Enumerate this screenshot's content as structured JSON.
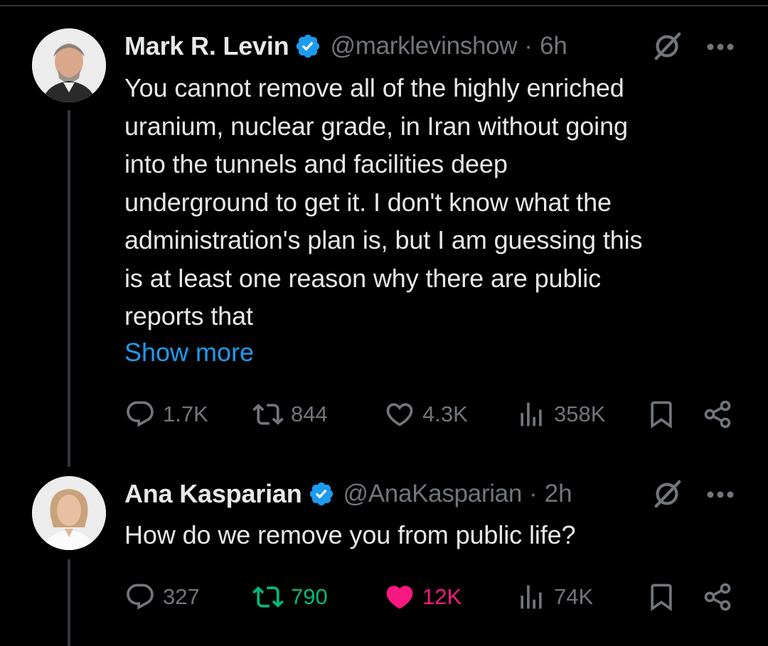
{
  "tweets": [
    {
      "author": {
        "name": "Mark R. Levin",
        "handle": "@marklevinshow",
        "avatar": "avatar-photo"
      },
      "separator": "·",
      "time": "6h",
      "lines": [
        "You cannot remove all of the highly enriched",
        "uranium, nuclear grade, in Iran without going",
        "into the tunnels and facilities deep",
        "underground to get it.  I don't know what the",
        "administration's plan is, but I am guessing this",
        "is at least one reason why there are public",
        "reports that"
      ],
      "show_more": "Show more",
      "stats": {
        "replies": "1.7K",
        "reposts": "844",
        "likes": "4.3K",
        "views": "358K"
      },
      "reposted": false,
      "liked": false
    },
    {
      "author": {
        "name": "Ana Kasparian",
        "handle": "@AnaKasparian",
        "avatar": "avatar-photo"
      },
      "separator": "·",
      "time": "2h",
      "lines": [
        "How do we remove you from public life?"
      ],
      "stats": {
        "replies": "327",
        "reposts": "790",
        "likes": "12K",
        "views": "74K"
      },
      "reposted": true,
      "liked": true
    }
  ],
  "colors": {
    "background": "#000000",
    "text": "#e7e9ea",
    "muted": "#71767b",
    "link": "#1d9bf0",
    "verified": "#1d9bf0",
    "repost_active": "#00ba7c",
    "like_active": "#f91880"
  },
  "icons": {
    "reply": "reply-icon",
    "repost": "repost-icon",
    "like": "heart-icon",
    "views": "views-icon",
    "bookmark": "bookmark-icon",
    "share": "share-icon",
    "grok": "grok-icon",
    "more": "more-icon",
    "verified": "verified-badge-icon"
  }
}
